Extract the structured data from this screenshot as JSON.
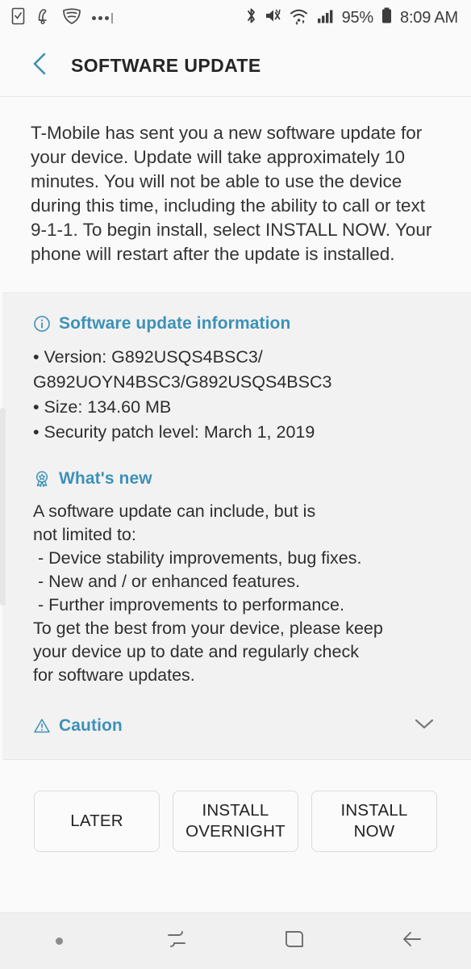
{
  "statusbar": {
    "left_icons": [
      "task-checkbox-icon",
      "notification-bell-icon",
      "vpn-shield-icon",
      "more-dots-icon"
    ],
    "right_icons": [
      "bluetooth-icon",
      "mute-vibrate-icon",
      "wifi-icon",
      "signal-bars-icon",
      "battery-icon"
    ],
    "battery_percent": "95%",
    "time": "8:09 AM"
  },
  "header": {
    "back_icon": "chevron-left-icon",
    "title": "SOFTWARE UPDATE"
  },
  "intro": {
    "text": "T-Mobile has sent you a new software update for your device. Update will take approximately 10 minutes. You will not be able to use the device during this time, including the ability to call or text 9-1-1. To begin install, select INSTALL NOW. Your phone will restart after the update is installed."
  },
  "info_section": {
    "icon": "info-circle-icon",
    "heading": "Software update information",
    "items": [
      "• Version: G892USQS4BSC3/\nG892UOYN4BSC3/G892USQS4BSC3",
      "• Size: 134.60 MB",
      "• Security patch level: March 1, 2019"
    ],
    "version": "G892USQS4BSC3/G892UOYN4BSC3/G892USQS4BSC3",
    "size": "134.60 MB",
    "security_patch_level": "March 1, 2019"
  },
  "whats_new_section": {
    "icon": "award-ribbon-icon",
    "heading": "What's new",
    "body": "A software update can include, but is\nnot limited to:\n - Device stability improvements, bug fixes.\n - New and / or enhanced features.\n - Further improvements to performance.\nTo get the best from your device, please keep\nyour device up to date and regularly check\nfor software updates."
  },
  "caution_section": {
    "icon": "warning-triangle-icon",
    "heading": "Caution",
    "expand_icon": "chevron-down-icon"
  },
  "buttons": {
    "later": "LATER",
    "install_overnight": "INSTALL\nOVERNIGHT",
    "install_now": "INSTALL NOW"
  },
  "navbar": {
    "items": [
      "nav-dot",
      "recents-icon",
      "home-icon",
      "back-arrow-icon"
    ]
  },
  "colors": {
    "accent": "#3d91b8",
    "text": "#2e2e2e",
    "panel_bg": "#f2f2f2",
    "page_bg": "#fafafa"
  }
}
